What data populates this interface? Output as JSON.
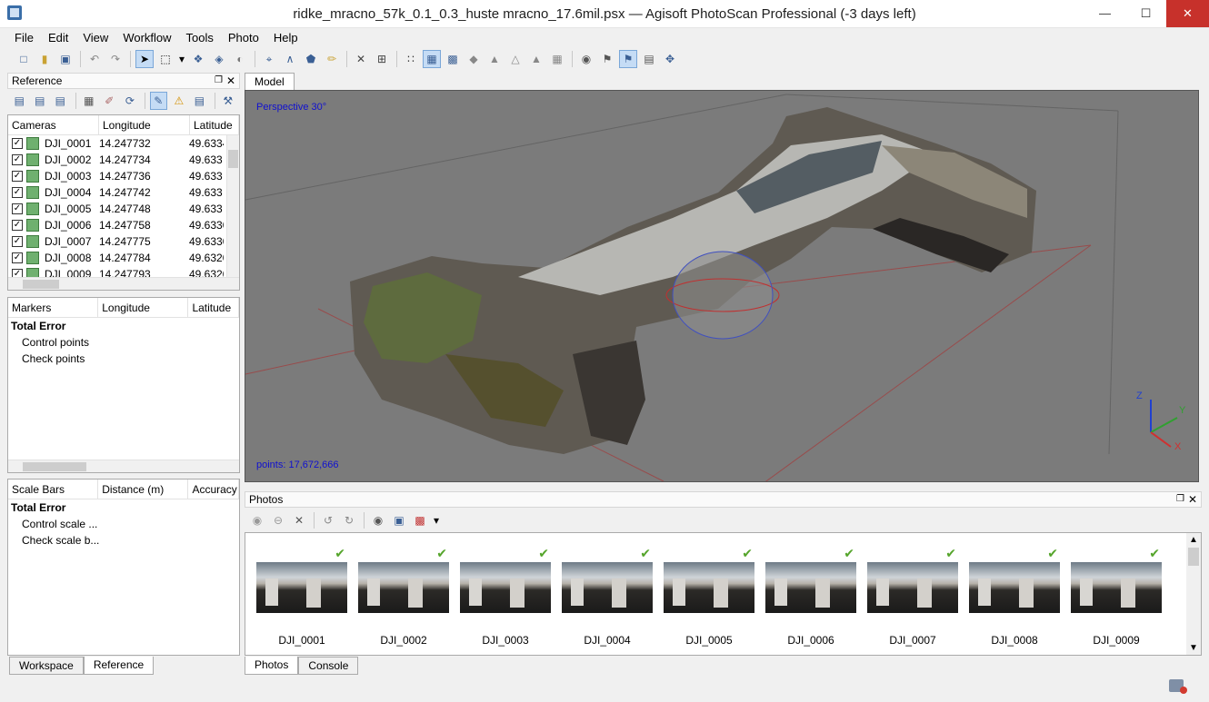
{
  "window": {
    "title": "ridke_mracno_57k_0.1_0.3_huste mracno_17.6mil.psx — Agisoft PhotoScan Professional (-3 days left)",
    "controls": {
      "minimize": "—",
      "maximize": "☐",
      "close": "✕"
    }
  },
  "menu": [
    "File",
    "Edit",
    "View",
    "Workflow",
    "Tools",
    "Photo",
    "Help"
  ],
  "reference_panel": {
    "title": "Reference",
    "cameras": {
      "headers": [
        "Cameras",
        "Longitude",
        "Latitude"
      ],
      "rows": [
        {
          "name": "DJI_0001",
          "lon": "14.247732",
          "lat": "49.6334"
        },
        {
          "name": "DJI_0002",
          "lon": "14.247734",
          "lat": "49.633"
        },
        {
          "name": "DJI_0003",
          "lon": "14.247736",
          "lat": "49.633"
        },
        {
          "name": "DJI_0004",
          "lon": "14.247742",
          "lat": "49.633"
        },
        {
          "name": "DJI_0005",
          "lon": "14.247748",
          "lat": "49.633"
        },
        {
          "name": "DJI_0006",
          "lon": "14.247758",
          "lat": "49.6330"
        },
        {
          "name": "DJI_0007",
          "lon": "14.247775",
          "lat": "49.6330"
        },
        {
          "name": "DJI_0008",
          "lon": "14.247784",
          "lat": "49.6320"
        },
        {
          "name": "DJI_0009",
          "lon": "14.247793",
          "lat": "49.6320"
        }
      ]
    },
    "markers": {
      "headers": [
        "Markers",
        "Longitude",
        "Latitude"
      ],
      "total": "Total Error",
      "items": [
        "Control points",
        "Check points"
      ]
    },
    "scalebars": {
      "headers": [
        "Scale Bars",
        "Distance (m)",
        "Accuracy"
      ],
      "total": "Total Error",
      "items": [
        "Control scale ...",
        "Check scale b..."
      ]
    },
    "tabs": [
      "Workspace",
      "Reference"
    ]
  },
  "model": {
    "tab": "Model",
    "perspective": "Perspective 30°",
    "points": "points: 17,672,666",
    "axes": {
      "z": "Z",
      "y": "Y",
      "x": "X"
    }
  },
  "photos_panel": {
    "title": "Photos",
    "photos": [
      "DJI_0001",
      "DJI_0002",
      "DJI_0003",
      "DJI_0004",
      "DJI_0005",
      "DJI_0006",
      "DJI_0007",
      "DJI_0008",
      "DJI_0009"
    ],
    "tabs": [
      "Photos",
      "Console"
    ]
  },
  "colors": {
    "viewport_bg": "#7b7b7b",
    "label_blue": "#1010d0",
    "check_green": "#55a52b",
    "close_red": "#c7312b"
  }
}
